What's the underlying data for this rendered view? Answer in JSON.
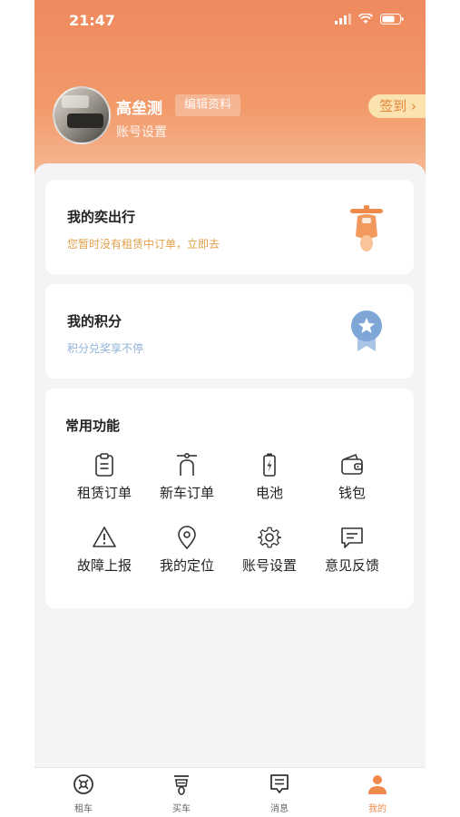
{
  "status_bar": {
    "time": "21:47"
  },
  "profile": {
    "name": "高垒测",
    "edit_label": "编辑资料",
    "account_settings_label": "账号设置",
    "checkin_label": "签到",
    "checkin_chevron": "›"
  },
  "my_trips": {
    "title": "我的奕出行",
    "subtitle": "您暂时没有租赁中订单，立即去",
    "icon": "scooter-icon"
  },
  "my_points": {
    "title": "我的积分",
    "subtitle": "积分兑奖享不停",
    "icon": "medal-icon"
  },
  "functions": {
    "title": "常用功能",
    "items": [
      {
        "label": "租赁订单",
        "icon": "clipboard-icon"
      },
      {
        "label": "新车订单",
        "icon": "scooter-outline-icon"
      },
      {
        "label": "电池",
        "icon": "battery-icon"
      },
      {
        "label": "钱包",
        "icon": "wallet-icon"
      },
      {
        "label": "故障上报",
        "icon": "warning-icon"
      },
      {
        "label": "我的定位",
        "icon": "location-pin-icon"
      },
      {
        "label": "账号设置",
        "icon": "gear-icon"
      },
      {
        "label": "意见反馈",
        "icon": "feedback-icon"
      }
    ]
  },
  "tabbar": {
    "items": [
      {
        "label": "租车",
        "icon": "steering-wheel-icon",
        "active": false
      },
      {
        "label": "买车",
        "icon": "scooter-front-icon",
        "active": false
      },
      {
        "label": "消息",
        "icon": "message-icon",
        "active": false
      },
      {
        "label": "我的",
        "icon": "person-icon",
        "active": true
      }
    ]
  },
  "colors": {
    "header_gradient_top": "#ef8a5e",
    "accent_orange": "#ef8a4c",
    "trip_subtitle": "#e2a04a",
    "points_subtitle": "#8fb2d6",
    "checkin_bg": "#fbe3b0"
  }
}
